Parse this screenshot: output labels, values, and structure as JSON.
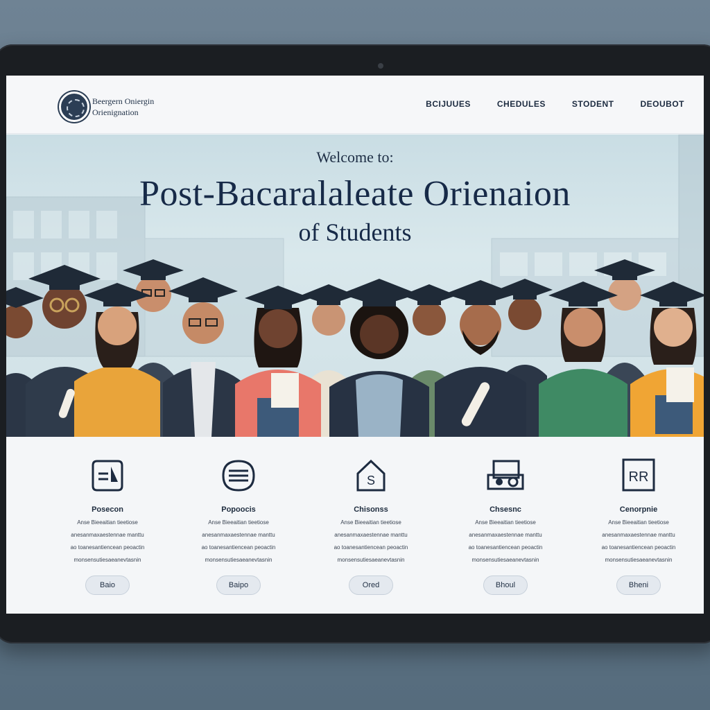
{
  "header": {
    "brand_line1": "Beergern Oniergin",
    "brand_line2": "Orienignation",
    "nav": [
      "BCIJUUES",
      "CHEDULES",
      "STODENT",
      "DEOUBOT"
    ]
  },
  "hero": {
    "welcome": "Welcome to:",
    "title": "Post-Bacaralaleate Orienaion",
    "subtitle": "of Students"
  },
  "features": [
    {
      "icon": "document-icon",
      "title": "Posecon",
      "lines": [
        "Anse Bieeaitian tieetiose",
        "anesanmaxaestennae manttu",
        "ao toanesantiencean peoactin",
        "monsensutiesaeanevtasnin"
      ],
      "button": "Baio"
    },
    {
      "icon": "burger-menu-icon",
      "title": "Popoocis",
      "lines": [
        "Anse Bieeaitian tieetiose",
        "anesanmaxaestennae manttu",
        "ao toanesantiencean peoactin",
        "monsensutiesaeanevtasnin"
      ],
      "button": "Baipo"
    },
    {
      "icon": "house-dollar-icon",
      "title": "Chisonss",
      "lines": [
        "Anse Bieeaitian tieetiose",
        "anesanmaxaestennae manttu",
        "ao toanesantiencean peoactin",
        "monsensutiesaeanevtasnin"
      ],
      "button": "Ored"
    },
    {
      "icon": "devices-icon",
      "title": "Chsesnc",
      "lines": [
        "Anse Bieeaitian tieetiose",
        "anesanmaxaestennae manttu",
        "ao toanesantiencean peoactin",
        "monsensutiesaeanevtasnin"
      ],
      "button": "Bhoul"
    },
    {
      "icon": "rr-badge-icon",
      "title": "Cenorpnie",
      "lines": [
        "Anse Bieeaitian tieetiose",
        "anesanmaxaestennae manttu",
        "ao toanesantiencean peoactin",
        "monsensutiesaeanevtasnin"
      ],
      "button": "Bheni"
    }
  ],
  "icons": {
    "rr_badge_text": "RR",
    "house_symbol": "S"
  },
  "colors": {
    "navy": "#172a48",
    "gown": "#253246",
    "sky": "#c9dde4",
    "screen_bg": "#f4f6f8"
  }
}
